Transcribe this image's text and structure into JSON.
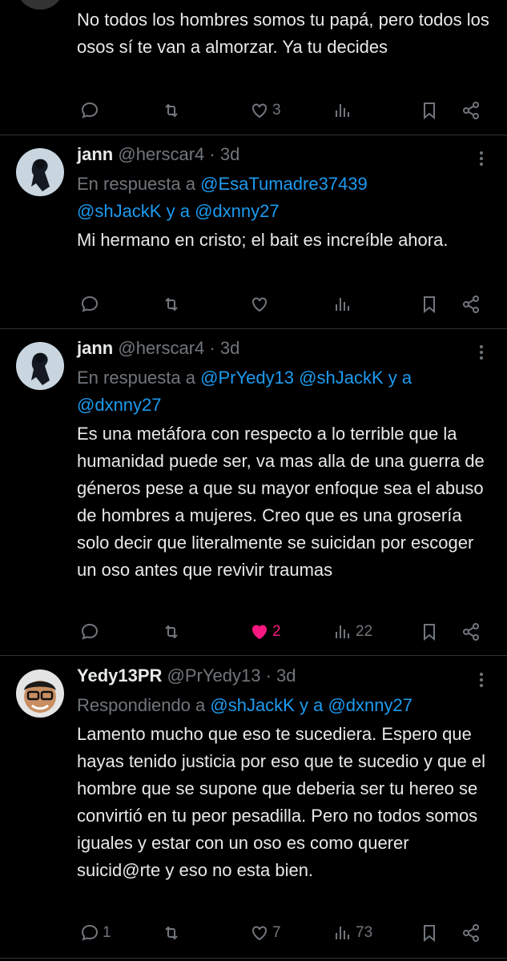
{
  "tweets": [
    {
      "text": "No todos los hombres somos tu papá, pero todos los osos sí te van a almorzar. Ya tu decides",
      "actions": {
        "replies": "",
        "retweets": "",
        "likes": "3",
        "views": ""
      }
    },
    {
      "name": "jann",
      "handle": "@herscar4",
      "time": "· 3d",
      "reply_prefix": "En respuesta a",
      "reply_user1": "@EsaTumadre37439",
      "reply_user2": "@shJackK",
      "reply_and": "y a",
      "reply_user3": "@dxnny27",
      "text": "Mi hermano en cristo; el bait es increíble ahora.",
      "actions": {
        "replies": "",
        "retweets": "",
        "likes": "",
        "views": ""
      }
    },
    {
      "name": "jann",
      "handle": "@herscar4",
      "time": "· 3d",
      "reply_prefix": "En respuesta a",
      "reply_user1": "@PrYedy13",
      "reply_user2": "@shJackK",
      "reply_and": "y a",
      "reply_user3": "@dxnny27",
      "text": "Es una metáfora con respecto a lo terrible que la humanidad puede ser, va mas alla de una guerra de géneros pese a que su mayor enfoque sea el abuso de hombres a mujeres. Creo que es una grosería solo decir que literalmente se suicidan por escoger un oso antes que revivir traumas",
      "actions": {
        "replies": "",
        "retweets": "",
        "likes": "2",
        "views": "22"
      }
    },
    {
      "name": "Yedy13PR",
      "handle": "@PrYedy13",
      "time": "· 3d",
      "reply_prefix": "Respondiendo a",
      "reply_user1": "@shJackK",
      "reply_and": "y a",
      "reply_user2": "@dxnny27",
      "text": "Lamento mucho que eso te sucediera. Espero que hayas tenido justicia por eso que te sucedio y que el hombre que se supone que deberia ser tu hereo se convirtió en tu peor pesadilla. Pero no todos somos iguales y estar con un oso es como querer suicid@rte y eso no esta bien.",
      "actions": {
        "replies": "1",
        "retweets": "",
        "likes": "7",
        "views": "73"
      }
    }
  ],
  "colors": {
    "background": "#000000",
    "text": "#e7e9ea",
    "muted": "#71767b",
    "link": "#1d9bf0",
    "like": "#f91880",
    "divider": "#2f3336"
  },
  "icons": [
    "reply-icon",
    "retweet-icon",
    "like-icon",
    "views-icon",
    "bookmark-icon",
    "share-icon",
    "more-icon"
  ]
}
